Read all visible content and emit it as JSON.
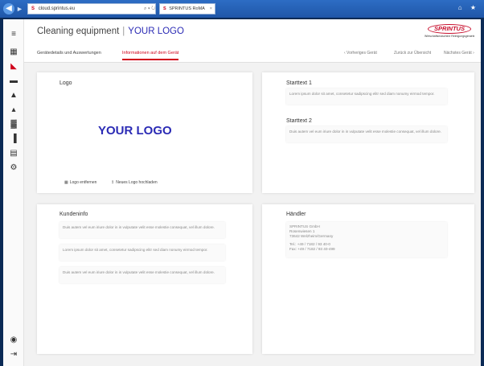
{
  "browser": {
    "address": "cloud.sprintus.eu",
    "address_icons": "⌕ ▾ ↻",
    "tab_title": "SPRINTUS RoMA",
    "tab_close": "×",
    "window_icons": "⌂ ★"
  },
  "header": {
    "title": "Cleaning equipment",
    "separator": "|",
    "logo_text": "YOUR LOGO",
    "brand_name": "SPRINTUS",
    "brand_tagline": "Wirtschaftsmaschine Reinigungsgeraete"
  },
  "sidebar": {
    "icons": [
      {
        "name": "menu-icon",
        "glyph": "≡"
      },
      {
        "name": "dashboard-icon",
        "glyph": "▦"
      },
      {
        "name": "sprintus-icon",
        "glyph": "◣"
      },
      {
        "name": "machine-icon",
        "glyph": "▬"
      },
      {
        "name": "user-icon",
        "glyph": "▲"
      },
      {
        "name": "users-icon",
        "glyph": "▴"
      },
      {
        "name": "chart-icon",
        "glyph": "▓"
      },
      {
        "name": "statistics-icon",
        "glyph": "▐"
      },
      {
        "name": "briefcase-icon",
        "glyph": "▤"
      },
      {
        "name": "settings-icon",
        "glyph": "⚙"
      }
    ],
    "bottom_icons": [
      {
        "name": "account-icon",
        "glyph": "◉"
      },
      {
        "name": "logout-icon",
        "glyph": "⇥"
      }
    ]
  },
  "subnav": {
    "tabs": [
      "Gerätedetails und Auswertungen",
      "Informationen auf dem Gerät"
    ],
    "active_index": 1,
    "right_links": [
      "‹ Vorheriges Gerät",
      "Zurück zur Übersicht",
      "Nächstes Gerät ›"
    ]
  },
  "cards": {
    "logo": {
      "title": "Logo",
      "logo_text": "YOUR LOGO",
      "remove_label": "Logo entfernen",
      "upload_label": "Neues Logo hochladen"
    },
    "starttext1": {
      "title": "Starttext 1",
      "text": "Lorem ipsum dolor sit amet, consetetur sadipscing elitr sed diam nonumy eirmod tempor."
    },
    "starttext2": {
      "title": "Starttext 2",
      "text": "Duis autem vel eum iriure dolor in in vulputate velit esse molestie consequat, vel illum dolore."
    },
    "kundeninfo": {
      "title": "Kundeninfo",
      "texts": [
        "Duis autem vel eum iriure dolor in in vulputate velit esse molestie consequat, vel illum dolore.",
        "Lorem ipsum dolor sit amet, consetetur sadipscing elitr sed diam nonumy eirmod tempor.",
        "Duis autem vel eum iriure dolor in in vulputate velit esse molestie consequat, vel illum dolore."
      ]
    },
    "haendler": {
      "title": "Händler",
      "lines": [
        "SPRINTUS GmbH",
        "Rosenwiesen 1",
        "73642 Welzheim/Germany",
        "",
        "Tel.: +49 / 7182 / 93 40-0",
        "Fax: +49 / 7182 / 93 40-499"
      ]
    }
  },
  "colors": {
    "accent": "#d0021b",
    "logo_blue": "#2b2bb5",
    "browser_blue": "#1f56a8"
  }
}
